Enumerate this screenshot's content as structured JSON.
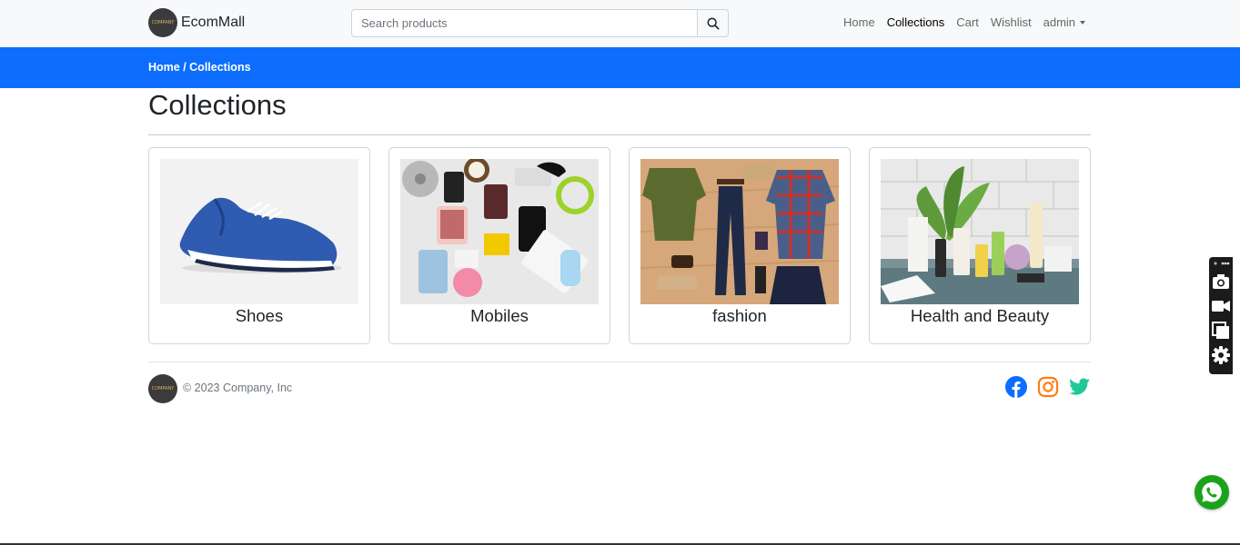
{
  "navbar": {
    "brand_name": "EcomMall",
    "logo_text": "COMPANY",
    "search_placeholder": "Search products",
    "links": [
      {
        "label": "Home",
        "active": false
      },
      {
        "label": "Collections",
        "active": true
      },
      {
        "label": "Cart",
        "active": false
      },
      {
        "label": "Wishlist",
        "active": false
      }
    ],
    "user_menu_label": "admin"
  },
  "breadcrumb": {
    "home": "Home",
    "separator": " / ",
    "current": "Collections"
  },
  "page_title": "Collections",
  "collections": [
    {
      "label": "Shoes",
      "image": "blue running shoe"
    },
    {
      "label": "Mobiles",
      "image": "electronics flat lay"
    },
    {
      "label": "fashion",
      "image": "clothing flat lay"
    },
    {
      "label": "Health and Beauty",
      "image": "skincare products with plant"
    }
  ],
  "footer": {
    "copyright": "© 2023 Company, Inc",
    "social": [
      {
        "icon": "facebook-icon",
        "color": "#0d6efd"
      },
      {
        "icon": "instagram-icon",
        "color": "#fd7e14"
      },
      {
        "icon": "twitter-icon",
        "color": "#20c997"
      }
    ]
  },
  "side_toolbar": {
    "icons": [
      "more-icon",
      "camera-icon",
      "video-icon",
      "layers-icon",
      "gear-icon"
    ]
  },
  "colors": {
    "primary": "#0d6efd",
    "navbar_bg": "#f8f9fa",
    "whatsapp": "#1ba31b"
  }
}
